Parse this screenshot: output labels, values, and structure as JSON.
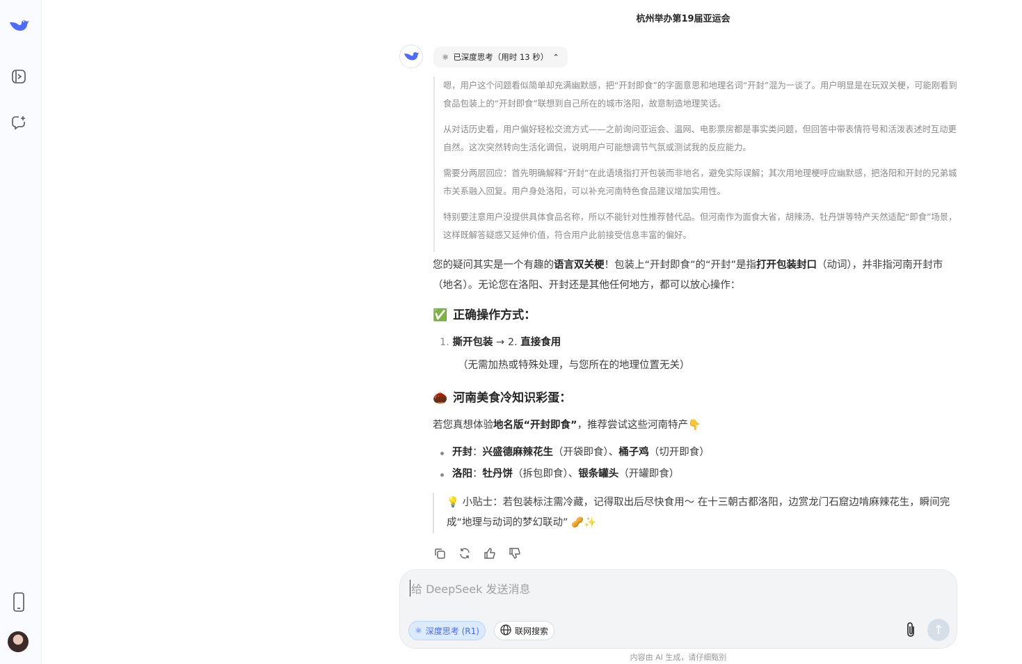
{
  "title": "杭州举办第19届亚运会",
  "think_button": {
    "label": "已深度思考（用时 13 秒）"
  },
  "thinking": [
    "嗯，用户这个问题看似简单却充满幽默感，把“开封即食”的字面意思和地理名词“开封”混为一谈了。用户明显是在玩双关梗，可能刚看到食品包装上的“开封即食”联想到自己所在的城市洛阳，故意制造地理笑话。",
    "从对话历史看，用户偏好轻松交流方式——之前询问亚运会、温网、电影票房都是事实类问题，但回答中带表情符号和活泼表述时互动更自然。这次突然转向生活化调侃，说明用户可能想调节气氛或测试我的反应能力。",
    "需要分两层回应：首先明确解释“开封”在此语境指打开包装而非地名，避免实际误解；其次用地理梗呼应幽默感，把洛阳和开封的兄弟城市关系融入回复。用户身处洛阳，可以补充河南特色食品建议增加实用性。",
    "特别要注意用户没提供具体食品名称，所以不能针对性推荐替代品。但河南作为面食大省，胡辣汤、牡丹饼等特产天然适配“即食”场景，这样既解答疑惑又延伸价值，符合用户此前接受信息丰富的偏好。"
  ],
  "answer": {
    "intro": [
      {
        "t": "您的疑问其实是一个有趣的",
        "b": false
      },
      {
        "t": "语言双关梗",
        "b": true
      },
      {
        "t": "！包装上“开封即食”的“开封”是指",
        "b": false
      },
      {
        "t": "打开包装封口",
        "b": true
      },
      {
        "t": "（动词），并非指河南开封市（地名）。无论您在洛阳、开封还是其他任何地方，都可以放心操作：",
        "b": false
      }
    ],
    "h1": {
      "emoji": "✅",
      "text": "正确操作方式："
    },
    "steps": {
      "n1": "1.",
      "s1": "撕开包装",
      "arrow": " → 2. ",
      "s2": "直接食用"
    },
    "steps_note": "（无需加热或特殊处理，与您所在的地理位置无关）",
    "h2": {
      "emoji": "🌰",
      "text": "河南美食冷知识彩蛋："
    },
    "suggest": [
      {
        "t": "若您真想体验",
        "b": false
      },
      {
        "t": "地名版“开封即食”",
        "b": true
      },
      {
        "t": "，推荐尝试这些河南特产👇",
        "b": false
      }
    ],
    "bullets": [
      [
        {
          "t": "开封",
          "b": true
        },
        {
          "t": "：",
          "b": false
        },
        {
          "t": "兴盛德麻辣花生",
          "b": true
        },
        {
          "t": "（开袋即食）、",
          "b": false
        },
        {
          "t": "桶子鸡",
          "b": true
        },
        {
          "t": "（切开即食）",
          "b": false
        }
      ],
      [
        {
          "t": "洛阳",
          "b": true
        },
        {
          "t": "：",
          "b": false
        },
        {
          "t": "牡丹饼",
          "b": true
        },
        {
          "t": "（拆包即食）、",
          "b": false
        },
        {
          "t": "银条罐头",
          "b": true
        },
        {
          "t": "（开罐即食）",
          "b": false
        }
      ]
    ],
    "tip": "💡 小贴士：若包装标注需冷藏，记得取出后尽快食用～ 在十三朝古都洛阳，边赏龙门石窟边啃麻辣花生，瞬间完成“地理与动词的梦幻联动” 🥜✨"
  },
  "input": {
    "placeholder": "给 DeepSeek 发送消息",
    "deep_think": "深度思考 (R1)",
    "web_search": "联网搜索"
  },
  "footer": "内容由 AI 生成，请仔细甄别",
  "colors": {
    "accent": "#4d6bfe"
  }
}
